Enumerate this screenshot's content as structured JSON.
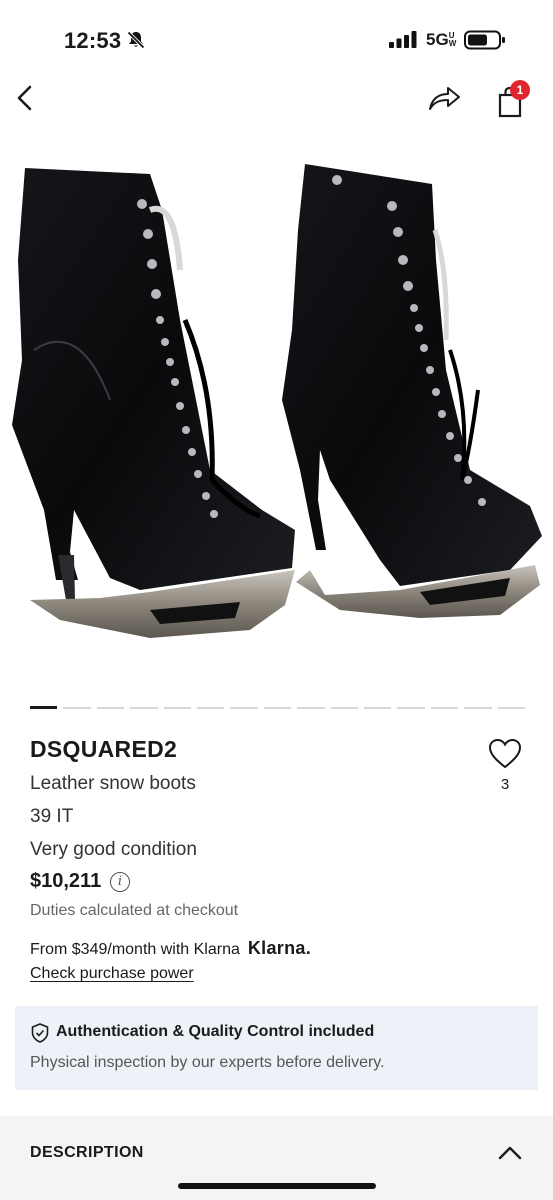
{
  "status_bar": {
    "time": "12:53",
    "network": "5G",
    "icons": [
      "bell-slash-icon",
      "signal-bars-icon",
      "battery-icon"
    ]
  },
  "nav": {
    "icons": [
      "back-chevron-icon",
      "share-arrow-icon",
      "shopping-bag-icon"
    ],
    "cart_count": "1",
    "badge_color": "#e0262d"
  },
  "product": {
    "brand": "DSQUARED2",
    "name": "Leather snow boots",
    "size": "39 IT",
    "condition": "Very good condition",
    "price": "$10,211",
    "duties": "Duties calculated at checkout",
    "klarna_text": "From $349/month with Klarna",
    "klarna_logo": "Klarna.",
    "check_power": "Check purchase power",
    "likes": "3",
    "image_count": 15,
    "current_image": 1
  },
  "auth": {
    "title": "Authentication & Quality Control included",
    "subtitle": "Physical inspection by our experts before delivery.",
    "background": "#eef2f8"
  },
  "description": {
    "title": "DESCRIPTION",
    "background": "#f4f4f4"
  }
}
